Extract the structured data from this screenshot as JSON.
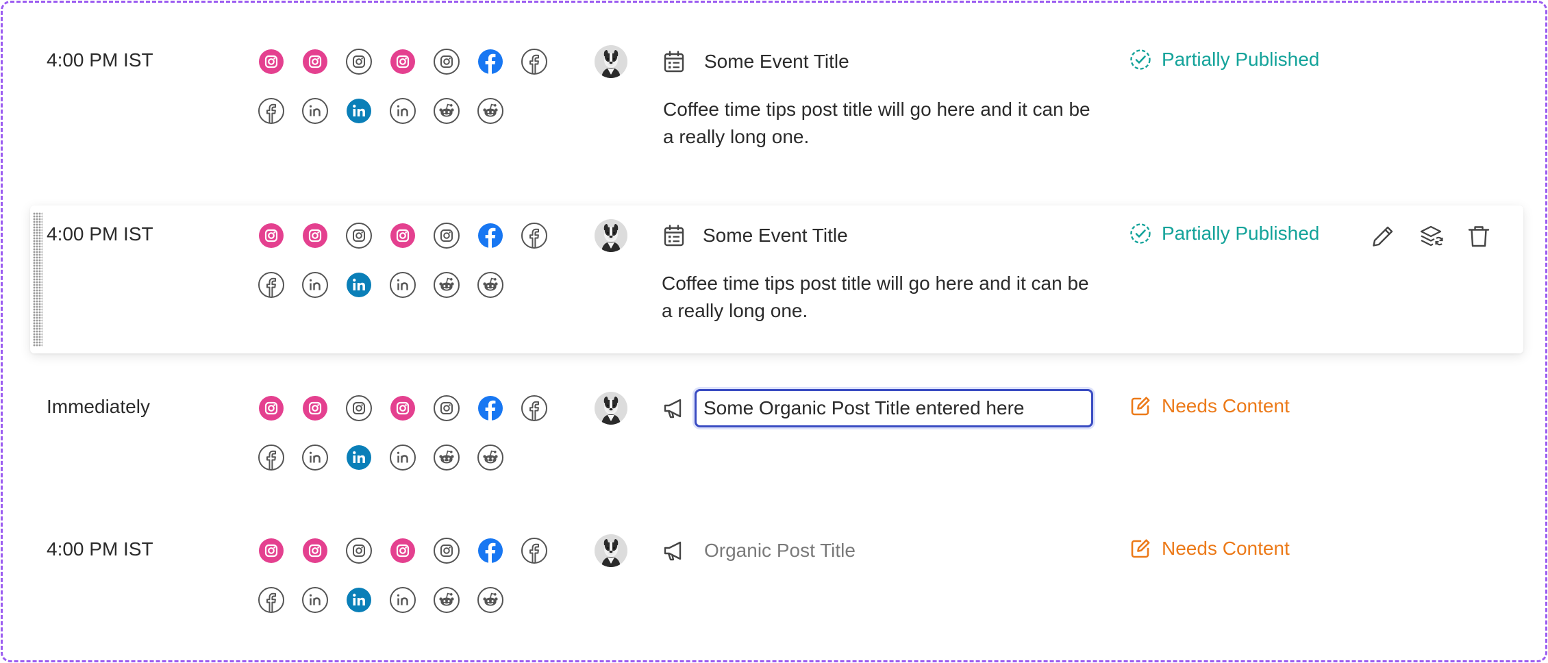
{
  "colors": {
    "instagram": "#e4408f",
    "facebook": "#1877f2",
    "linkedin": "#0a7fb8",
    "outline": "#555555",
    "published": "#14a39a",
    "needs_content": "#ec7a19",
    "frame_border": "#9b5cf0",
    "input_focus": "#3a4cc2"
  },
  "social_icons": {
    "row1": [
      "instagram-filled",
      "instagram-filled",
      "instagram-outline",
      "instagram-filled",
      "instagram-outline",
      "facebook-filled",
      "facebook-outline"
    ],
    "row2": [
      "facebook-outline",
      "linkedin-outline",
      "linkedin-filled",
      "linkedin-outline",
      "reddit-outline",
      "reddit-outline"
    ]
  },
  "posts": [
    {
      "time": "4:00 PM IST",
      "type_icon": "calendar-icon",
      "title": "Some Event Title",
      "description": "Coffee time tips post title will go here and it can be a really long one.",
      "status": "Partially Published",
      "status_icon": "dashed-check-circle-icon"
    },
    {
      "time": "4:00 PM IST",
      "type_icon": "calendar-icon",
      "title": "Some Event Title",
      "description": "Coffee time tips post title will go here and it can be a really long one.",
      "status": "Partially Published",
      "status_icon": "dashed-check-circle-icon",
      "actions": [
        "pencil-icon",
        "layers-sync-icon",
        "trash-icon"
      ]
    },
    {
      "time": "Immediately",
      "type_icon": "megaphone-icon",
      "title_input_value": "Some Organic Post Title entered here",
      "status": "Needs Content",
      "status_icon": "edit-square-icon"
    },
    {
      "time": "4:00 PM IST",
      "type_icon": "megaphone-icon",
      "title": "Organic Post Title",
      "status": "Needs Content",
      "status_icon": "edit-square-icon"
    }
  ]
}
